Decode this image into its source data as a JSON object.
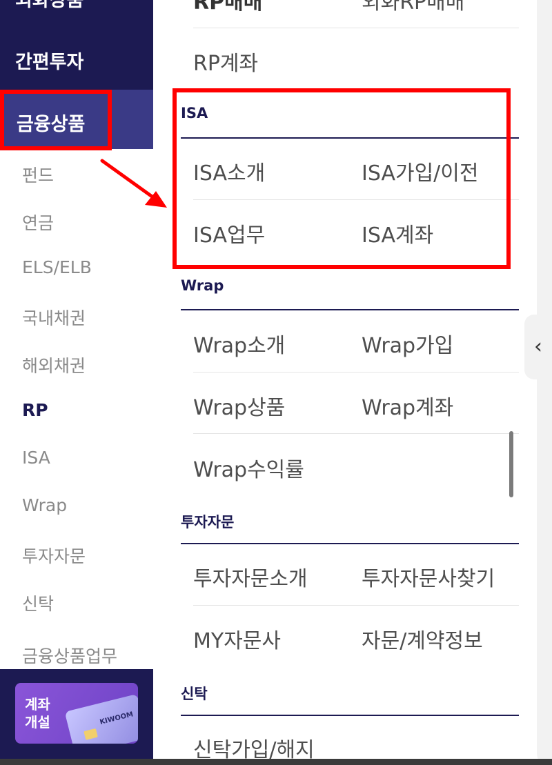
{
  "sidebar": {
    "top_items": [
      "외화상품",
      "간편투자"
    ],
    "active_item": "금융상품",
    "sub_items": [
      "펀드",
      "연금",
      "ELS/ELB",
      "국내채권",
      "해외채권",
      "RP",
      "ISA",
      "Wrap",
      "투자자문",
      "신탁",
      "금융상품업무"
    ],
    "current_sub_item": "RP",
    "open_account": {
      "label_line1": "계좌",
      "label_line2": "개설",
      "card_brand": "KIWOOM"
    }
  },
  "main": {
    "rp_partial_row": [
      "RP매매",
      "외화RP매매"
    ],
    "rp_account": "RP계좌",
    "sections": [
      {
        "title": "ISA",
        "links": [
          "ISA소개",
          "ISA가입/이전",
          "ISA업무",
          "ISA계좌"
        ]
      },
      {
        "title": "Wrap",
        "links": [
          "Wrap소개",
          "Wrap가입",
          "Wrap상품",
          "Wrap계좌",
          "Wrap수익률"
        ]
      },
      {
        "title": "투자자문",
        "links": [
          "투자자문소개",
          "투자자문사찾기",
          "MY자문사",
          "자문/계약정보"
        ]
      },
      {
        "title": "신탁",
        "links": [
          "신탁가입/해지"
        ]
      }
    ]
  },
  "collapse_tab": {
    "glyph": "‹"
  },
  "colors": {
    "navy": "#1c1a52",
    "active": "#3a3a86",
    "annotation": "#ff0000",
    "promo": "#7a4bd0"
  },
  "icons": {
    "collapse": "chevron-left-icon",
    "annotation_arrow": "arrow-icon"
  }
}
